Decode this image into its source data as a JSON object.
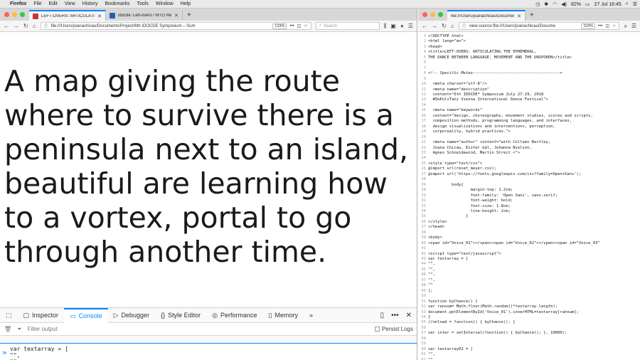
{
  "menubar": {
    "app": "Firefox",
    "items": [
      "File",
      "Edit",
      "View",
      "History",
      "Bookmarks",
      "Tools",
      "Window",
      "Help"
    ],
    "battery": "82%",
    "datetime": "27 Jul 16:45"
  },
  "left_window": {
    "tabs": [
      {
        "title": "LEFT-OVERS: ARTICULATING THE",
        "active": true
      },
      {
        "title": "idocde: Left-overs / MTO Resid",
        "active": false
      }
    ],
    "url": "file:///Users/joanachicau/Documents/Project/6th IDOCDE Symposium – Sum",
    "zoom": "133%",
    "search_placeholder": "Search",
    "page_text": "A map giving the route where to survive there is a peninsula next to an island, beautiful are learning how to a vortex, portal to go through another time."
  },
  "devtools": {
    "tabs": [
      "Inspector",
      "Console",
      "Debugger",
      "Style Editor",
      "Performance",
      "Memory"
    ],
    "active_tab": "Console",
    "filter_placeholder": "Filter output",
    "persist_label": "Persist Logs",
    "console_lines": [
      "var textarray = [",
      "\"\",",
      "\"\","
    ]
  },
  "right_window": {
    "tab_title": "file:///Users/joanachicau/Documen",
    "url": "view-source:file:///Users/joanachicau/Docume",
    "zoom": "110%",
    "source_lines": [
      {
        "n": "1",
        "t": "<!DOCTYPE html>",
        "c": "com"
      },
      {
        "n": "2",
        "t": "<html lang=\"en\">",
        "c": "tag"
      },
      {
        "n": "3",
        "t": "<head>",
        "c": "tag"
      },
      {
        "n": "4",
        "t": "<title>LEFT-OVERS: ARTICULATING THE EPHEMERAL,",
        "c": "tag"
      },
      {
        "n": "5",
        "t": "THE DANCE BETWEEN LANGUAGE, MOVEMENT AND THE UNSPOKEN</title>",
        "c": ""
      },
      {
        "n": "6",
        "t": "",
        "c": ""
      },
      {
        "n": "7",
        "t": "",
        "c": ""
      },
      {
        "n": "8",
        "t": "<!-- Specific Metas———————————————————————————————————-->",
        "c": "com"
      },
      {
        "n": "9",
        "t": "",
        "c": ""
      },
      {
        "n": "10",
        "t": "  <meta charset=\"utf-8\"/>",
        "c": "tag"
      },
      {
        "n": "11",
        "t": "  <meta name=\"description\"",
        "c": "tag"
      },
      {
        "n": "12",
        "t": "  content=\"6th IDOCDE* Symposium July 27-29, 2018",
        "c": "blue"
      },
      {
        "n": "13",
        "t": "  #ImPulsTanz Vienna International Dance Festival\">",
        "c": "blue"
      },
      {
        "n": "14",
        "t": "",
        "c": ""
      },
      {
        "n": "15",
        "t": "  <meta name=\"keywords\"",
        "c": "tag"
      },
      {
        "n": "16",
        "t": "  content=\"design, choreography, movement studies, scores and scripts,",
        "c": "blue"
      },
      {
        "n": "17",
        "t": "  composition methods, programming languages, and interfaces,",
        "c": "blue"
      },
      {
        "n": "18",
        "t": "  design visualizations and interventions, perception,",
        "c": "blue"
      },
      {
        "n": "19",
        "t": "  corporeality, hybrid practices.\">",
        "c": "blue"
      },
      {
        "n": "20",
        "t": "",
        "c": ""
      },
      {
        "n": "21",
        "t": "  <meta name=\"author\" content=\"with Colleen Bartley,",
        "c": "tag"
      },
      {
        "n": "22",
        "t": "  Joana Chicau, Eszter Gál, Johanna Nielson,",
        "c": "blue"
      },
      {
        "n": "23",
        "t": "  Agnes Schneidewind, Martin Streit <\">",
        "c": "blue"
      },
      {
        "n": "24",
        "t": "",
        "c": ""
      },
      {
        "n": "25",
        "t": "<style type=\"text/css\">",
        "c": "tag"
      },
      {
        "n": "26",
        "t": "@import url(reset_meyer.css);",
        "c": ""
      },
      {
        "n": "27",
        "t": "@import url('https://fonts.googleapis.com/css?family=Open+Sans');",
        "c": ""
      },
      {
        "n": "28",
        "t": "",
        "c": ""
      },
      {
        "n": "29",
        "t": "          body{",
        "c": ""
      },
      {
        "n": "30",
        "t": "                  margin-top: 1.2cm;",
        "c": ""
      },
      {
        "n": "31",
        "t": "                  font-family: 'Open Sans', sans-serif;",
        "c": ""
      },
      {
        "n": "32",
        "t": "                  font-weight: bold;",
        "c": ""
      },
      {
        "n": "33",
        "t": "                  font-size: 1.8cm;",
        "c": ""
      },
      {
        "n": "34",
        "t": "                  line-height: 2cm;",
        "c": ""
      },
      {
        "n": "35",
        "t": "                }",
        "c": ""
      },
      {
        "n": "36",
        "t": "</style>",
        "c": "tag"
      },
      {
        "n": "37",
        "t": "</head>",
        "c": "tag"
      },
      {
        "n": "38",
        "t": "",
        "c": ""
      },
      {
        "n": "39",
        "t": "<body>",
        "c": "tag"
      },
      {
        "n": "40",
        "t": "<span id=\"Voice_01\"></span><span id=\"Voice_02\"></span><span id=\"Voice_03\"",
        "c": "tag"
      },
      {
        "n": "41",
        "t": "",
        "c": ""
      },
      {
        "n": "42",
        "t": "<script type=\"text/javascript\">",
        "c": "tag"
      },
      {
        "n": "43",
        "t": "var textarray = [",
        "c": ""
      },
      {
        "n": "44",
        "t": "\"\",",
        "c": ""
      },
      {
        "n": "45",
        "t": "\"\",",
        "c": ""
      },
      {
        "n": "46",
        "t": "\"\",",
        "c": ""
      },
      {
        "n": "47",
        "t": "\"\",",
        "c": ""
      },
      {
        "n": "48",
        "t": "\"\"",
        "c": ""
      },
      {
        "n": "49",
        "t": "];",
        "c": ""
      },
      {
        "n": "50",
        "t": "",
        "c": ""
      },
      {
        "n": "51",
        "t": "function byChance() {",
        "c": ""
      },
      {
        "n": "52",
        "t": "var rannum= Math.floor(Math.random()*textarray.length);",
        "c": ""
      },
      {
        "n": "53",
        "t": "document.getElementById('Voice_01').innerHTML=textarray[rannum];",
        "c": ""
      },
      {
        "n": "54",
        "t": "}",
        "c": ""
      },
      {
        "n": "55",
        "t": "//onload = function() { byChance(); }",
        "c": ""
      },
      {
        "n": "56",
        "t": "",
        "c": ""
      },
      {
        "n": "57",
        "t": "var inter = setInterval(function() { byChance(); }, 10000);",
        "c": ""
      },
      {
        "n": "58",
        "t": "",
        "c": ""
      },
      {
        "n": "59",
        "t": "",
        "c": ""
      },
      {
        "n": "60",
        "t": "var textarray02 = [",
        "c": ""
      },
      {
        "n": "61",
        "t": "\"\",",
        "c": ""
      },
      {
        "n": "62",
        "t": "\"\",",
        "c": ""
      },
      {
        "n": "63",
        "t": "\"\",",
        "c": ""
      }
    ]
  }
}
